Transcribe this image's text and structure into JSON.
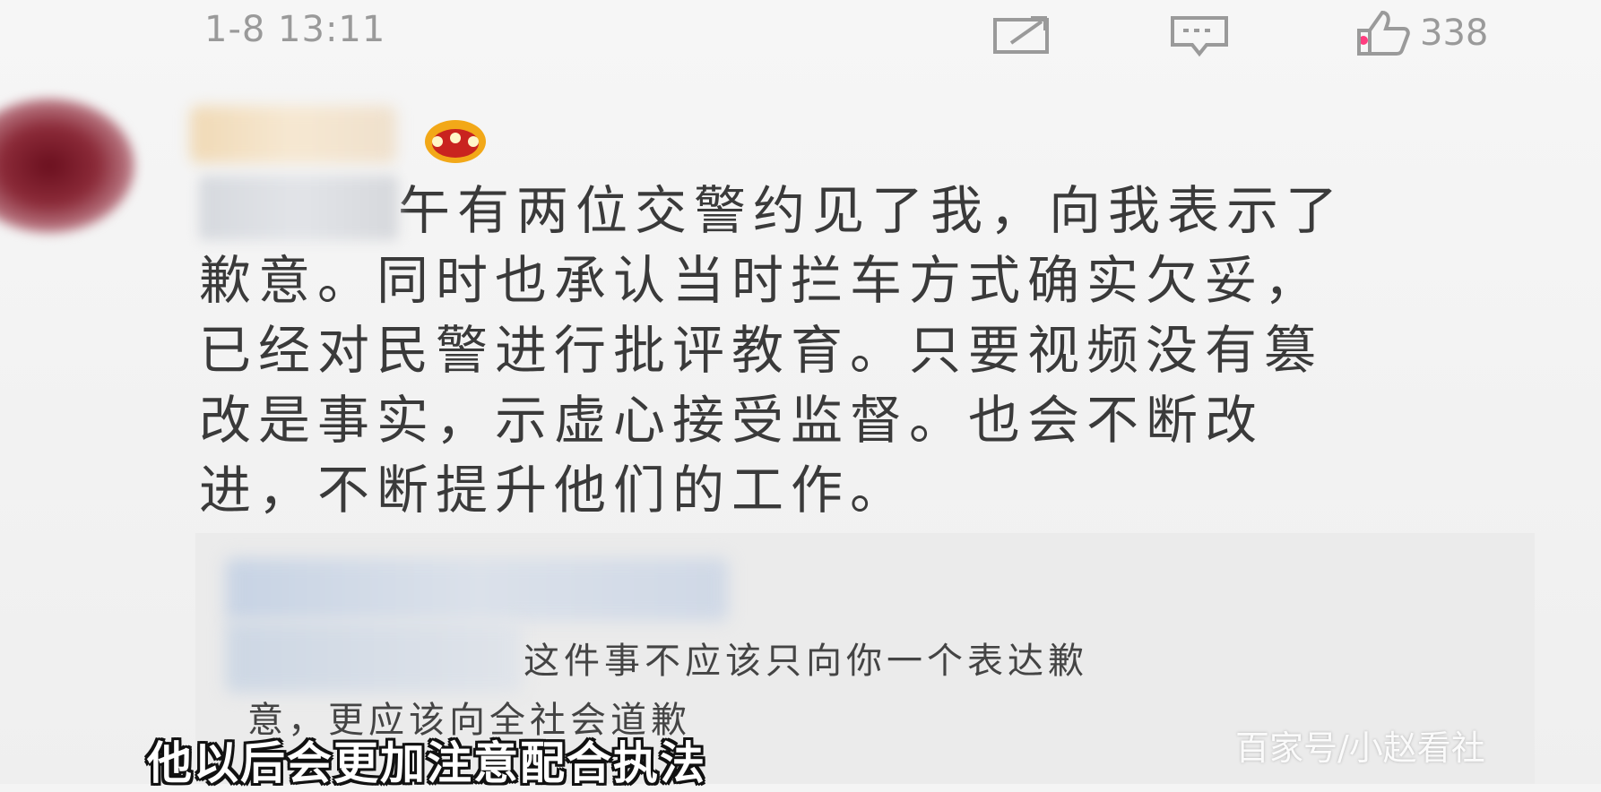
{
  "post": {
    "timestamp": "1-8 13:11",
    "like_count": "338",
    "icons": [
      "share-icon",
      "comment-icon",
      "like-icon"
    ],
    "lines": [
      "午有两位交警约见了我，向我表示了",
      "歉意。同时也承认当时拦车方式确实欠妥，",
      "已经对民警进行批评教育。只要视频没有篡",
      "改是事实，示虚心接受监督。也会不断改",
      "进，不断提升他们的工作。"
    ]
  },
  "reply": {
    "line1": "这件事不应该只向你一个表达歉",
    "line2": "意，更应该向全社会道歉"
  },
  "overlay": {
    "subtitle": "他以后会更加注意配合执法",
    "watermark": "百家号/小赵看社"
  },
  "colors": {
    "background": "#f4f4f4",
    "text": "#3a3a3a",
    "meta_text": "#9a9a9a",
    "accent_pink": "#ff3d7f",
    "reply_bg": "#ebebeb"
  }
}
